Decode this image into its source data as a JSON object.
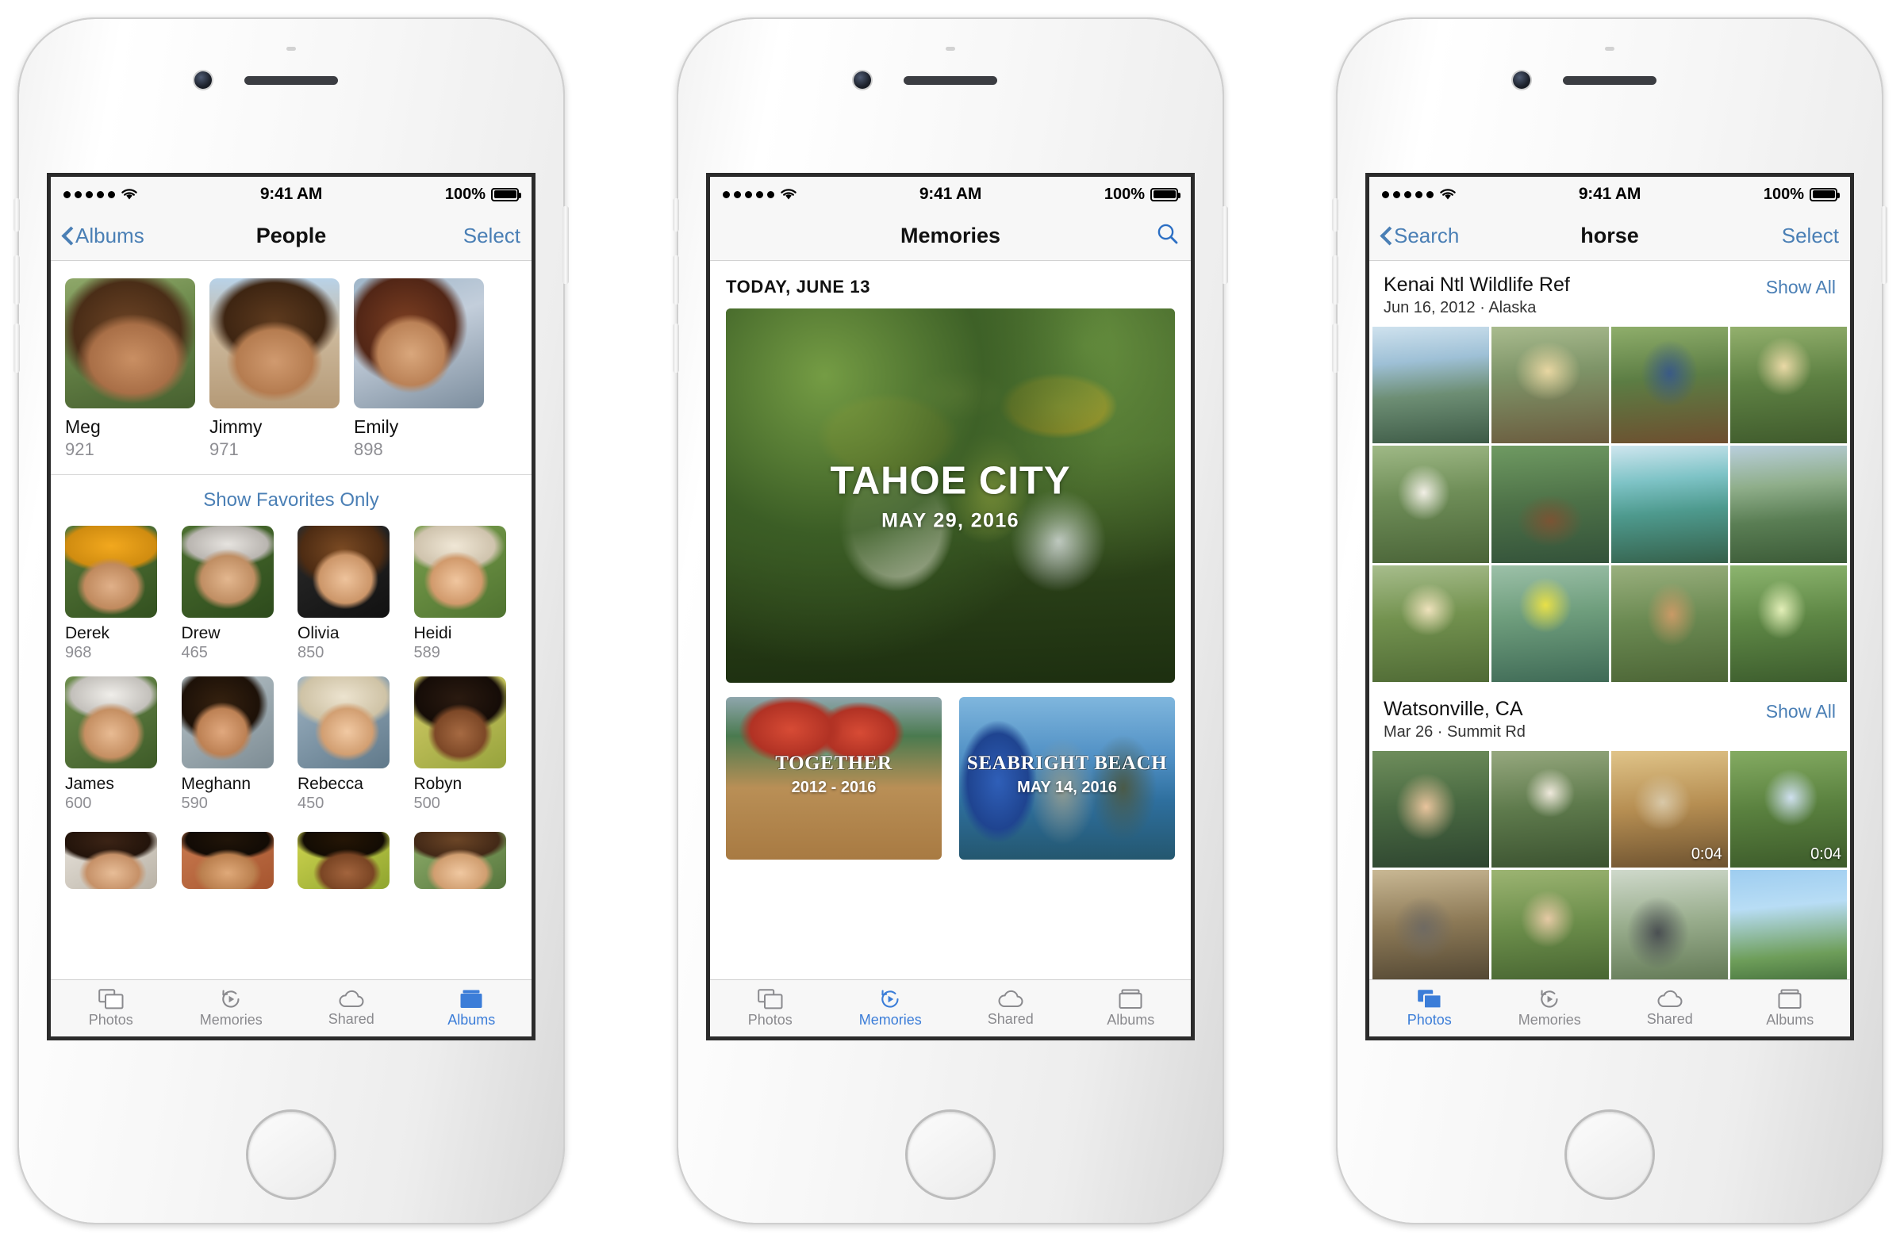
{
  "status_bar": {
    "time": "9:41 AM",
    "battery": "100%",
    "signal_dots": 5,
    "wifi": "wifi-icon"
  },
  "phones": [
    {
      "id": "phone-people",
      "nav": {
        "back_label": "Albums",
        "title": "People",
        "right_label": "Select"
      },
      "favorites": [
        {
          "name": "Meg",
          "count": "921"
        },
        {
          "name": "Jimmy",
          "count": "971"
        },
        {
          "name": "Emily",
          "count": "898"
        }
      ],
      "favorites_toggle": "Show Favorites Only",
      "people": [
        {
          "name": "Derek",
          "count": "968"
        },
        {
          "name": "Drew",
          "count": "465"
        },
        {
          "name": "Olivia",
          "count": "850"
        },
        {
          "name": "Heidi",
          "count": "589"
        },
        {
          "name": "James",
          "count": "600"
        },
        {
          "name": "Meghann",
          "count": "590"
        },
        {
          "name": "Rebecca",
          "count": "450"
        },
        {
          "name": "Robyn",
          "count": "500"
        }
      ],
      "tabs": [
        {
          "label": "Photos",
          "icon": "photos-icon",
          "active": false
        },
        {
          "label": "Memories",
          "icon": "memories-icon",
          "active": false
        },
        {
          "label": "Shared",
          "icon": "shared-icon",
          "active": false
        },
        {
          "label": "Albums",
          "icon": "albums-icon",
          "active": true
        }
      ]
    },
    {
      "id": "phone-memories",
      "nav": {
        "title": "Memories",
        "search_icon": "search-icon"
      },
      "section_date": "TODAY, JUNE 13",
      "hero": {
        "title": "TAHOE CITY",
        "subtitle": "MAY 29, 2016"
      },
      "cards": [
        {
          "title": "TOGETHER",
          "subtitle": "2012 - 2016"
        },
        {
          "title": "SEABRIGHT BEACH",
          "subtitle": "MAY 14, 2016"
        }
      ],
      "tabs": [
        {
          "label": "Photos",
          "icon": "photos-icon",
          "active": false
        },
        {
          "label": "Memories",
          "icon": "memories-icon",
          "active": true
        },
        {
          "label": "Shared",
          "icon": "shared-icon",
          "active": false
        },
        {
          "label": "Albums",
          "icon": "albums-icon",
          "active": false
        }
      ]
    },
    {
      "id": "phone-search",
      "nav": {
        "back_label": "Search",
        "title": "horse",
        "right_label": "Select"
      },
      "sections": [
        {
          "title": "Kenai Ntl Wildlife Ref",
          "subtitle": "Jun 16, 2012 · Alaska",
          "show_all": "Show All",
          "rows": 3,
          "durations": {}
        },
        {
          "title": "Watsonville, CA",
          "subtitle": "Mar 26 · Summit Rd",
          "show_all": "Show All",
          "rows": 2,
          "durations": {
            "2": "0:04",
            "3": "0:04"
          }
        }
      ],
      "tabs": [
        {
          "label": "Photos",
          "icon": "photos-icon",
          "active": true
        },
        {
          "label": "Memories",
          "icon": "memories-icon",
          "active": false
        },
        {
          "label": "Shared",
          "icon": "shared-icon",
          "active": false
        },
        {
          "label": "Albums",
          "icon": "albums-icon",
          "active": false
        }
      ]
    }
  ],
  "colors": {
    "accent": "#4a7fb5",
    "tab_active": "#3b7dd8",
    "secondary_text": "#8e8e93",
    "bar_bg": "#f7f7f7"
  }
}
